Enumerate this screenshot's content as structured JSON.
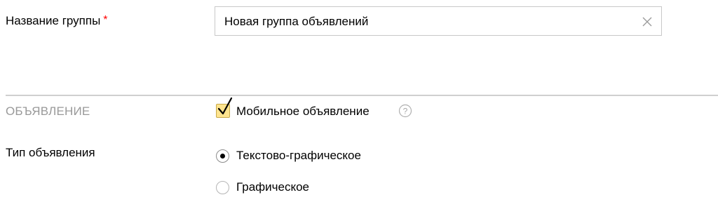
{
  "group_name": {
    "label": "Название группы",
    "required_mark": "*",
    "value": "Новая группа объявлений"
  },
  "section": {
    "title": "ОБЪЯВЛЕНИЕ"
  },
  "mobile_ad": {
    "label": "Мобильное объявление",
    "checked": true,
    "help_icon": "question-circle-icon"
  },
  "ad_type": {
    "label": "Тип объявления",
    "options": [
      {
        "label": "Текстово-графическое",
        "selected": true
      },
      {
        "label": "Графическое",
        "selected": false
      }
    ]
  },
  "colors": {
    "required": "#ff0000",
    "checkbox_fill": "#ffe48e",
    "section_title": "#999999",
    "divider": "#cfcfcf"
  }
}
